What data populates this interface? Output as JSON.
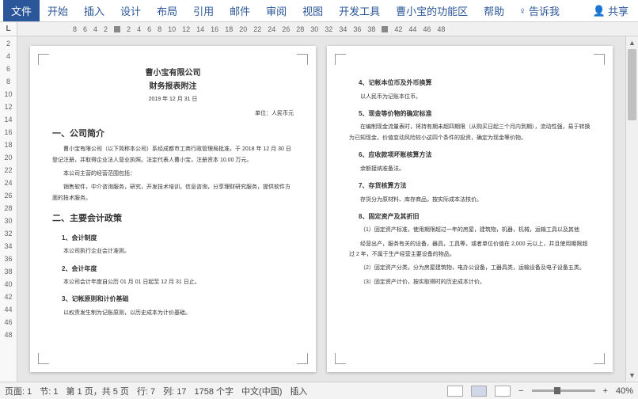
{
  "ribbon": {
    "file": "文件",
    "tabs": [
      "开始",
      "插入",
      "设计",
      "布局",
      "引用",
      "邮件",
      "审阅",
      "视图",
      "开发工具",
      "曹小宝的功能区",
      "帮助"
    ],
    "tell_me_icon": "♀",
    "tell_me": "告诉我",
    "share_icon": "👤",
    "share": "共享"
  },
  "ruler": {
    "corner": "L",
    "h_left": [
      "8",
      "6",
      "4",
      "2"
    ],
    "h_right": [
      "2",
      "4",
      "6",
      "8",
      "10",
      "12",
      "14",
      "16",
      "18",
      "20",
      "22",
      "24",
      "26",
      "28",
      "30",
      "32",
      "34",
      "36",
      "38"
    ],
    "h_far": [
      "42",
      "44",
      "46",
      "48"
    ],
    "v": [
      "2",
      "4",
      "6",
      "8",
      "10",
      "12",
      "14",
      "16",
      "18",
      "20",
      "22",
      "24",
      "26",
      "28",
      "30",
      "32",
      "34",
      "36",
      "38",
      "40",
      "42",
      "44",
      "46",
      "48"
    ]
  },
  "doc": {
    "company": "曹小宝有限公司",
    "subtitle": "财务报表附注",
    "date": "2019 年 12 月 31 日",
    "unit": "单位：人民币元",
    "s1": "一、公司简介",
    "s1p1": "曹小宝有限公司（以下简称本公司）系经成都市工商行政管理局批准，于 2018 年 12 月 30 日登记注册，并取得企业法人营业执照。法定代表人曹小宝，注册资本 10.00 万元。",
    "s1p2": "本公司主营的经营范围包括：",
    "s1p3": "销售软件，中介咨询服务，研究，开发技术培训，信息咨询，分享理财研究服务，提供软件方面的技术服务。",
    "s2": "二、主要会计政策",
    "s2_1": "1、会计制度",
    "s2_1p": "本公司执行企业会计准则。",
    "s2_2": "2、会计年度",
    "s2_2p": "本公司会计年度自公历 01 月 01 日起至 12 月 31 日止。",
    "s2_3": "3、记帐原则和计价基础",
    "s2_3p": "以权责发生制为记账原则，以历史成本为计价基础。",
    "s2_4": "4、记帐本位币及外币换算",
    "s2_4p": "以人民币为记账本位币。",
    "s2_5": "5、现金等价物的确定标准",
    "s2_5p": "在编制现金流量表时，将持有期未超四期限（从购买日起三个月内到期），流动性强，易于转换为已知现金，价值变动风险较小这四个条件的投资，确定为现金等价物。",
    "s2_6": "6、应收款项坏账核算方法",
    "s2_6p": "余额接纳准备法。",
    "s2_7": "7、存货核算方法",
    "s2_7p": "存货分为原材料、库存商品，按实际成本法核价。",
    "s2_8": "8、固定资产及其折旧",
    "s2_8p1": "（1）固定资产标准，使用期限超过一年的房屋，建筑物，机器，机械，运输工具以及其他",
    "s2_8p2": "经营出产，服务有关的设备，器具，工具等，或者单位价值在 2,000 元以上，并且使用期限超过 2 年，不属于生产经营主要设备的物品。",
    "s2_8p3": "（2）固定资产分类，分为房屋建筑物，电办公设备，工器具类，运输设备及电子设备五类。",
    "s2_8p4": "（3）固定资产计价，按实取得时的历史成本计价。"
  },
  "status": {
    "page": "页面: 1",
    "section": "节: 1",
    "page_of": "第 1 页，共 5 页",
    "row": "行: 7",
    "col": "列: 17",
    "words": "1758 个字",
    "lang": "中文(中国)",
    "insert": "插入",
    "zoom_out": "−",
    "zoom_in": "+",
    "zoom": "40%"
  }
}
